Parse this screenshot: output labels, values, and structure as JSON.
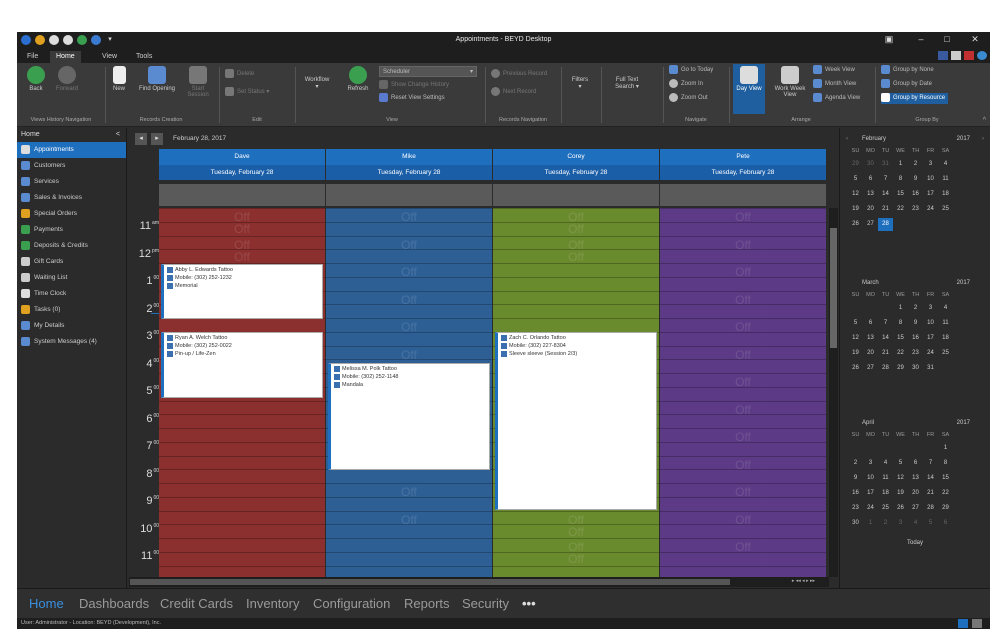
{
  "window": {
    "title": "Appointments - BEYD Desktop"
  },
  "menu_tabs": [
    "File",
    "Home",
    "View",
    "Tools"
  ],
  "ribbon": {
    "back": "Back",
    "forward": "Forward",
    "views_history": "Views History Navigation",
    "new": "New",
    "find_opening": "Find Opening",
    "start_session": "Start Session",
    "records_creation": "Records Creation",
    "delete": "Delete",
    "set_status": "Set Status",
    "edit": "Edit",
    "workflow": "Workflow",
    "refresh": "Refresh",
    "view_select": "Scheduler",
    "show_change_history": "Show Change History",
    "reset_view_settings": "Reset View Settings",
    "view": "View",
    "previous_record": "Previous Record",
    "next_record": "Next Record",
    "records_navigation": "Records Navigation",
    "filters": "Filters",
    "full_text_search": "Full Text Search",
    "go_to_today": "Go to Today",
    "zoom_in": "Zoom In",
    "zoom_out": "Zoom Out",
    "navigate": "Navigate",
    "day_view": "Day View",
    "work_week_view": "Work Week View",
    "week_view": "Week View",
    "month_view": "Month View",
    "agenda_view": "Agenda View",
    "arrange": "Arrange",
    "group_by_none": "Group by None",
    "group_by_date": "Group by Date",
    "group_by_resource": "Group by Resource",
    "group_by": "Group By"
  },
  "nav": {
    "header": "Home",
    "items": [
      "Appointments",
      "Customers",
      "Services",
      "Sales & Invoices",
      "Special Orders",
      "Payments",
      "Deposits & Credits",
      "Gift Cards",
      "Waiting List",
      "Time Clock",
      "Tasks (0)",
      "My Details",
      "System Messages (4)"
    ]
  },
  "calendar": {
    "date_label": "February 28, 2017",
    "resources": [
      {
        "name": "Dave",
        "date": "Tuesday, February 28",
        "color": "#8b2f2f"
      },
      {
        "name": "Mike",
        "date": "Tuesday, February 28",
        "color": "#2d5f95"
      },
      {
        "name": "Corey",
        "date": "Tuesday, February 28",
        "color": "#6a8a2e"
      },
      {
        "name": "Pete",
        "date": "Tuesday, February 28",
        "color": "#5c3a85"
      }
    ],
    "off_label": "Off",
    "hours": [
      {
        "h": "11",
        "m": "am"
      },
      {
        "h": "12",
        "m": "pm"
      },
      {
        "h": "1",
        "m": "00"
      },
      {
        "h": "2",
        "m": "00"
      },
      {
        "h": "3",
        "m": "00"
      },
      {
        "h": "4",
        "m": "00"
      },
      {
        "h": "5",
        "m": "00"
      },
      {
        "h": "6",
        "m": "00"
      },
      {
        "h": "7",
        "m": "00"
      },
      {
        "h": "8",
        "m": "00"
      },
      {
        "h": "9",
        "m": "00"
      },
      {
        "h": "10",
        "m": "00"
      },
      {
        "h": "11",
        "m": "00"
      }
    ],
    "appointments": [
      {
        "lines": [
          "Abby L. Edwards Tattoo",
          "Mobile: (302) 252-1232",
          "Memorial"
        ]
      },
      {
        "lines": [
          "Ryan A. Welch Tattoo",
          "Mobile: (302) 252-0022",
          "Pin-up / Life-Zen"
        ]
      },
      {
        "lines": [
          "Melissa M. Polk Tattoo",
          "Mobile: (302) 252-1148",
          "Mandala"
        ]
      },
      {
        "lines": [
          "Zach C. Orlando Tattoo",
          "Mobile: (302) 227-8304",
          "Sleeve sleeve (Session 2/3)"
        ]
      }
    ]
  },
  "mini_calendars": [
    {
      "month": "February",
      "year": "2017",
      "weeks": [
        [
          "29",
          "30",
          "31",
          "1",
          "2",
          "3",
          "4"
        ],
        [
          "5",
          "6",
          "7",
          "8",
          "9",
          "10",
          "11"
        ],
        [
          "12",
          "13",
          "14",
          "15",
          "16",
          "17",
          "18"
        ],
        [
          "19",
          "20",
          "21",
          "22",
          "23",
          "24",
          "25"
        ],
        [
          "26",
          "27",
          "28",
          "",
          "",
          "",
          ""
        ]
      ],
      "selected": "28"
    },
    {
      "month": "March",
      "year": "2017",
      "weeks": [
        [
          "",
          "",
          "",
          "1",
          "2",
          "3",
          "4"
        ],
        [
          "5",
          "6",
          "7",
          "8",
          "9",
          "10",
          "11"
        ],
        [
          "12",
          "13",
          "14",
          "15",
          "16",
          "17",
          "18"
        ],
        [
          "19",
          "20",
          "21",
          "22",
          "23",
          "24",
          "25"
        ],
        [
          "26",
          "27",
          "28",
          "29",
          "30",
          "31",
          ""
        ]
      ]
    },
    {
      "month": "April",
      "year": "2017",
      "weeks": [
        [
          "",
          "",
          "",
          "",
          "",
          "",
          "1"
        ],
        [
          "2",
          "3",
          "4",
          "5",
          "6",
          "7",
          "8"
        ],
        [
          "9",
          "10",
          "11",
          "12",
          "13",
          "14",
          "15"
        ],
        [
          "16",
          "17",
          "18",
          "19",
          "20",
          "21",
          "22"
        ],
        [
          "23",
          "24",
          "25",
          "26",
          "27",
          "28",
          "29"
        ],
        [
          "30",
          "1",
          "2",
          "3",
          "4",
          "5",
          "6"
        ]
      ]
    }
  ],
  "dow": [
    "SU",
    "MO",
    "TU",
    "WE",
    "TH",
    "FR",
    "SA"
  ],
  "today_label": "Today",
  "bottom_nav": [
    "Home",
    "Dashboards",
    "Credit Cards",
    "Inventory",
    "Configuration",
    "Reports",
    "Security",
    "•••"
  ],
  "status": "User: Administrator - Location: BEYD (Development), Inc."
}
